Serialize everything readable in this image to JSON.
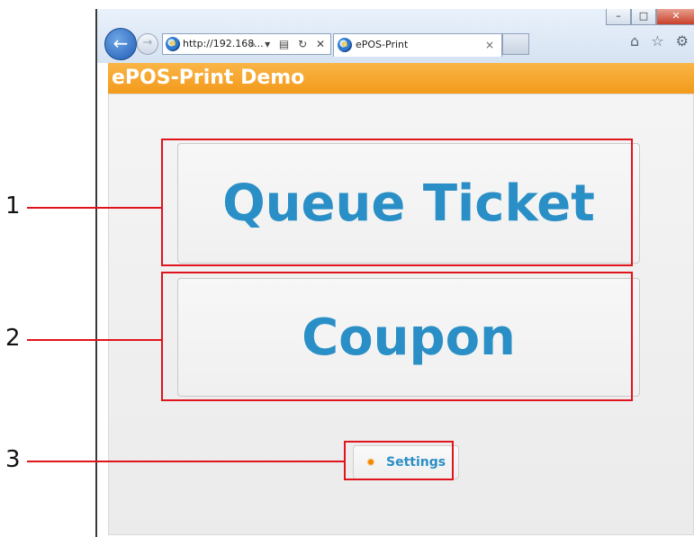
{
  "browser": {
    "address": "http://192.168...",
    "address_tools": "⌕ ▾ ▤ ↻ ✕",
    "tab_title": "ePOS-Print",
    "tab_close": "×",
    "right_icons": "⌂ ☆ ⚙",
    "window_controls": {
      "minimize": "–",
      "maximize": "□",
      "close": "✕"
    },
    "back_icon": "←",
    "forward_icon": "→"
  },
  "app": {
    "title": "ePOS-Print Demo",
    "buttons": {
      "queue_ticket": "Queue Ticket",
      "coupon": "Coupon",
      "settings": "Settings"
    }
  },
  "annotations": {
    "labels": [
      "1",
      "2",
      "3"
    ]
  },
  "colors": {
    "title_bar": "#f39a1a",
    "button_text": "#2a8fc6",
    "highlight": "#e0141c",
    "settings_icon": "#f08a00"
  }
}
